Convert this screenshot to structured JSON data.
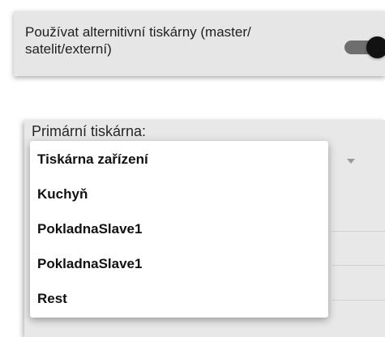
{
  "alt_printers": {
    "label": "Používat alternitivní tiskárny (master/ satelit/externí)",
    "enabled": true
  },
  "primary_printer": {
    "title": "Primární tiskárna:",
    "options": [
      "Tiskárna zařízení",
      "Kuchyň",
      "PokladnaSlave1",
      "PokladnaSlave1",
      "Rest"
    ]
  },
  "icons": {
    "dropdown": "chevron-down-icon"
  }
}
